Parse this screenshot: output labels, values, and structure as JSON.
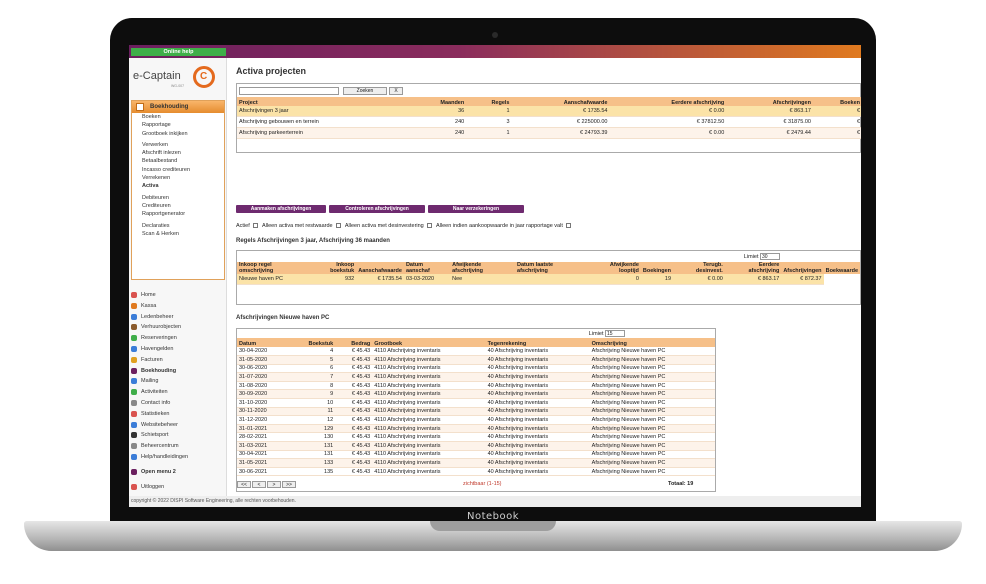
{
  "device": {
    "brand": "Notebook"
  },
  "topbar": {
    "help_label": "Online help"
  },
  "logo": {
    "text": "e-Captain",
    "sub": "WG-007"
  },
  "menu": {
    "header": "Boekhouding",
    "items": [
      {
        "label": "Boeken"
      },
      {
        "label": "Rapportage"
      },
      {
        "label": "Grootboek inkijken"
      },
      {
        "label": "Verwerken"
      },
      {
        "label": "Afschrift inlezen"
      },
      {
        "label": "Betaalbestand"
      },
      {
        "label": "Incasso crediteuren"
      },
      {
        "label": "Verrekenen"
      },
      {
        "label": "Activa"
      },
      {
        "label": "Debiteuren"
      },
      {
        "label": "Crediteuren"
      },
      {
        "label": "Rapportgenerator"
      },
      {
        "label": "Declaraties"
      },
      {
        "label": "Scan & Herken"
      }
    ]
  },
  "mainmenu": [
    {
      "label": "Home",
      "color": "#d9534f"
    },
    {
      "label": "Kassa",
      "color": "#e07a1f"
    },
    {
      "label": "Ledenbeheer",
      "color": "#3b7dd8"
    },
    {
      "label": "Verhuurobjecten",
      "color": "#8a5a2b"
    },
    {
      "label": "Reserveringen",
      "color": "#3fae49"
    },
    {
      "label": "Havengelden",
      "color": "#3b7dd8"
    },
    {
      "label": "Facturen",
      "color": "#e0a020"
    },
    {
      "label": "Boekhouding",
      "color": "#6b1f5f"
    },
    {
      "label": "Mailing",
      "color": "#3b7dd8"
    },
    {
      "label": "Activiteiten",
      "color": "#3fae49"
    },
    {
      "label": "Contact info",
      "color": "#888888"
    },
    {
      "label": "Statistieken",
      "color": "#d9534f"
    },
    {
      "label": "Websitebeheer",
      "color": "#3b7dd8"
    },
    {
      "label": "Schietsport",
      "color": "#333333"
    },
    {
      "label": "Beheercentrum",
      "color": "#888888"
    },
    {
      "label": "Help/handleidingen",
      "color": "#3b7dd8"
    },
    {
      "label": "Open menu 2",
      "color": "#6b1f5f"
    },
    {
      "label": "Uitloggen",
      "color": "#d9534f"
    }
  ],
  "page": {
    "title": "Activa projecten"
  },
  "search": {
    "button": "Zoeken",
    "clear": "X"
  },
  "projects": {
    "headers": [
      "Project",
      "Maanden",
      "Regels",
      "Aanschafwaarde",
      "Eerdere afschrijving",
      "Afschrijvingen",
      "Boeken"
    ],
    "rows": [
      [
        "Afschrijvingen 3 jaar",
        "36",
        "1",
        "€ 1735.54",
        "€ 0.00",
        "€ 863.17",
        "€"
      ],
      [
        "Afschrijving gebouwen en terrein",
        "240",
        "3",
        "€ 225000.00",
        "€ 37812.50",
        "€ 31875.00",
        "€"
      ],
      [
        "Afschrijving parkeerterrein",
        "240",
        "1",
        "€ 24793.39",
        "€ 0.00",
        "€ 2479.44",
        "€"
      ]
    ]
  },
  "actions": [
    "Aanmaken afschrijvingen",
    "Controleren afschrijvingen",
    "Naar verzekeringen"
  ],
  "filters": [
    "Actief",
    "Alleen activa met restwaarde",
    "Alleen activa met desinvestering",
    "Alleen indien aankoopwaarde in jaar rapportage valt"
  ],
  "rules": {
    "title": "Regels Afschrijvingen 3 jaar, Afschrijving 36 maanden",
    "limit_label": "Limiet",
    "limit_value": "30",
    "headers": [
      "Inkoop regel omschrijving",
      "Inkoop boekstuk",
      "Aanschafwaarde",
      "Datum aanschaf",
      "Afwijkende afschrijving",
      "Datum laatste afschrijving",
      "Afwijkende looptijd",
      "Boekingen",
      "Terugb. desinvest.",
      "Eerdere afschrijving",
      "Afschrijvingen",
      "Boekwaarde"
    ],
    "row": [
      "Nieuwe haven PC",
      "932",
      "€ 1735.54",
      "03-03-2020",
      "Nee",
      "",
      "0",
      "19",
      "€ 0.00",
      "€ 863.17",
      "€ 872.37"
    ]
  },
  "entries": {
    "title": "Afschrijvingen Nieuwe haven PC",
    "limit_label": "Limiet",
    "limit_value": "15",
    "headers": [
      "Datum",
      "Boekstuk",
      "Bedrag",
      "Grootboek",
      "Tegenrekening",
      "Omschrijving"
    ],
    "rows": [
      [
        "30-04-2020",
        "4",
        "€ 45.43",
        "4110 Afschrijving inventaris",
        "40 Afschrijving inventaris",
        "Afschrijving Nieuwe haven PC"
      ],
      [
        "31-05-2020",
        "5",
        "€ 45.43",
        "4110 Afschrijving inventaris",
        "40 Afschrijving inventaris",
        "Afschrijving Nieuwe haven PC"
      ],
      [
        "30-06-2020",
        "6",
        "€ 45.43",
        "4110 Afschrijving inventaris",
        "40 Afschrijving inventaris",
        "Afschrijving Nieuwe haven PC"
      ],
      [
        "31-07-2020",
        "7",
        "€ 45.43",
        "4110 Afschrijving inventaris",
        "40 Afschrijving inventaris",
        "Afschrijving Nieuwe haven PC"
      ],
      [
        "31-08-2020",
        "8",
        "€ 45.43",
        "4110 Afschrijving inventaris",
        "40 Afschrijving inventaris",
        "Afschrijving Nieuwe haven PC"
      ],
      [
        "30-09-2020",
        "9",
        "€ 45.43",
        "4110 Afschrijving inventaris",
        "40 Afschrijving inventaris",
        "Afschrijving Nieuwe haven PC"
      ],
      [
        "31-10-2020",
        "10",
        "€ 45.43",
        "4110 Afschrijving inventaris",
        "40 Afschrijving inventaris",
        "Afschrijving Nieuwe haven PC"
      ],
      [
        "30-11-2020",
        "11",
        "€ 45.43",
        "4110 Afschrijving inventaris",
        "40 Afschrijving inventaris",
        "Afschrijving Nieuwe haven PC"
      ],
      [
        "31-12-2020",
        "12",
        "€ 45.43",
        "4110 Afschrijving inventaris",
        "40 Afschrijving inventaris",
        "Afschrijving Nieuwe haven PC"
      ],
      [
        "31-01-2021",
        "129",
        "€ 45.43",
        "4110 Afschrijving inventaris",
        "40 Afschrijving inventaris",
        "Afschrijving Nieuwe haven PC"
      ],
      [
        "28-02-2021",
        "130",
        "€ 45.43",
        "4110 Afschrijving inventaris",
        "40 Afschrijving inventaris",
        "Afschrijving Nieuwe haven PC"
      ],
      [
        "31-03-2021",
        "131",
        "€ 45.43",
        "4110 Afschrijving inventaris",
        "40 Afschrijving inventaris",
        "Afschrijving Nieuwe haven PC"
      ],
      [
        "30-04-2021",
        "131",
        "€ 45.43",
        "4110 Afschrijving inventaris",
        "40 Afschrijving inventaris",
        "Afschrijving Nieuwe haven PC"
      ],
      [
        "31-05-2021",
        "133",
        "€ 45.43",
        "4110 Afschrijving inventaris",
        "40 Afschrijving inventaris",
        "Afschrijving Nieuwe haven PC"
      ],
      [
        "30-06-2021",
        "135",
        "€ 45.43",
        "4110 Afschrijving inventaris",
        "40 Afschrijving inventaris",
        "Afschrijving Nieuwe haven PC"
      ]
    ],
    "pager": [
      "<<",
      "<",
      ">",
      ">>"
    ],
    "visible": "zichtbaar (1-15)",
    "total": "Totaal: 19"
  },
  "footer": "copyright © 2022 DISPI Software Engineering, alle rechten voorbehouden."
}
